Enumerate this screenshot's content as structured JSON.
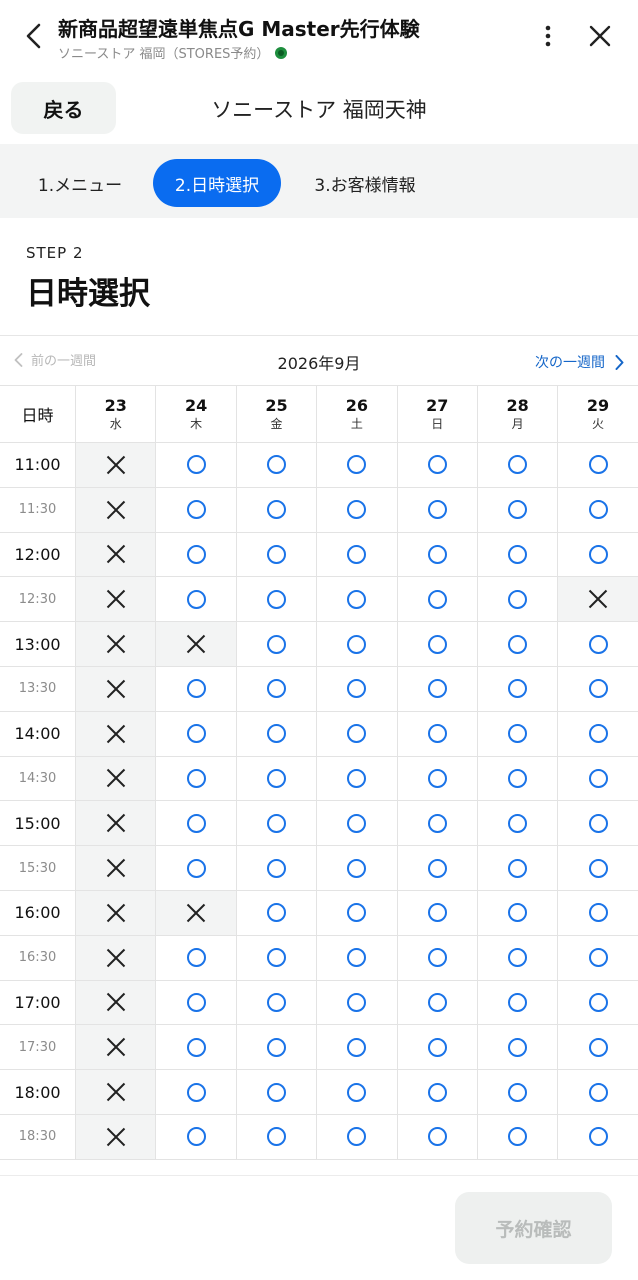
{
  "appbar": {
    "title": "新商品超望遠単焦点G Master先行体験",
    "subtitle": "ソニーストア 福岡（STORES予約）"
  },
  "store": {
    "back_label": "戻る",
    "name": "ソニーストア 福岡天神"
  },
  "steps": [
    {
      "label": "1.メニュー",
      "active": false
    },
    {
      "label": "2.日時選択",
      "active": true
    },
    {
      "label": "3.お客様情報",
      "active": false
    }
  ],
  "heading": {
    "step_label": "STEP 2",
    "title": "日時選択"
  },
  "week_nav": {
    "prev_label": "前の一週間",
    "month": "2026年9月",
    "next_label": "次の一週間"
  },
  "calendar": {
    "time_header": "日時",
    "days": [
      {
        "date": "23",
        "weekday": "水"
      },
      {
        "date": "24",
        "weekday": "木"
      },
      {
        "date": "25",
        "weekday": "金"
      },
      {
        "date": "26",
        "weekday": "土"
      },
      {
        "date": "27",
        "weekday": "日"
      },
      {
        "date": "28",
        "weekday": "月"
      },
      {
        "date": "29",
        "weekday": "火"
      }
    ],
    "slots": [
      {
        "time": "11:00",
        "availability": [
          "x",
          "o",
          "o",
          "o",
          "o",
          "o",
          "o"
        ]
      },
      {
        "time": "11:30",
        "availability": [
          "x",
          "o",
          "o",
          "o",
          "o",
          "o",
          "o"
        ]
      },
      {
        "time": "12:00",
        "availability": [
          "x",
          "o",
          "o",
          "o",
          "o",
          "o",
          "o"
        ]
      },
      {
        "time": "12:30",
        "availability": [
          "x",
          "o",
          "o",
          "o",
          "o",
          "o",
          "x"
        ]
      },
      {
        "time": "13:00",
        "availability": [
          "x",
          "x",
          "o",
          "o",
          "o",
          "o",
          "o"
        ]
      },
      {
        "time": "13:30",
        "availability": [
          "x",
          "o",
          "o",
          "o",
          "o",
          "o",
          "o"
        ]
      },
      {
        "time": "14:00",
        "availability": [
          "x",
          "o",
          "o",
          "o",
          "o",
          "o",
          "o"
        ]
      },
      {
        "time": "14:30",
        "availability": [
          "x",
          "o",
          "o",
          "o",
          "o",
          "o",
          "o"
        ]
      },
      {
        "time": "15:00",
        "availability": [
          "x",
          "o",
          "o",
          "o",
          "o",
          "o",
          "o"
        ]
      },
      {
        "time": "15:30",
        "availability": [
          "x",
          "o",
          "o",
          "o",
          "o",
          "o",
          "o"
        ]
      },
      {
        "time": "16:00",
        "availability": [
          "x",
          "x",
          "o",
          "o",
          "o",
          "o",
          "o"
        ]
      },
      {
        "time": "16:30",
        "availability": [
          "x",
          "o",
          "o",
          "o",
          "o",
          "o",
          "o"
        ]
      },
      {
        "time": "17:00",
        "availability": [
          "x",
          "o",
          "o",
          "o",
          "o",
          "o",
          "o"
        ]
      },
      {
        "time": "17:30",
        "availability": [
          "x",
          "o",
          "o",
          "o",
          "o",
          "o",
          "o"
        ]
      },
      {
        "time": "18:00",
        "availability": [
          "x",
          "o",
          "o",
          "o",
          "o",
          "o",
          "o"
        ]
      },
      {
        "time": "18:30",
        "availability": [
          "x",
          "o",
          "o",
          "o",
          "o",
          "o",
          "o"
        ]
      }
    ]
  },
  "confirm_label": "予約確認",
  "colors": {
    "accent": "#0a6cf0",
    "available": "#1a73e8",
    "unavailable_bg": "#f3f4f4"
  }
}
